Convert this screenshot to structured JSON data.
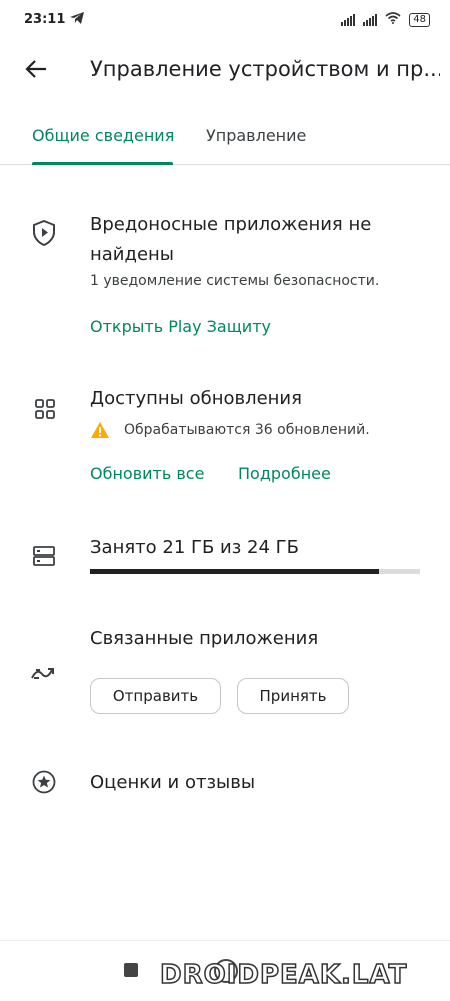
{
  "status": {
    "time": "23:11",
    "battery": "48"
  },
  "appbar": {
    "title": "Управление устройством и пр..."
  },
  "tabs": [
    {
      "label": "Общие сведения",
      "active": true
    },
    {
      "label": "Управление",
      "active": false
    }
  ],
  "protect": {
    "title": "Вредоносные приложения не найдены",
    "subtitle": "1 уведомление системы безопасности.",
    "link": "Открыть Play Защиту"
  },
  "updates": {
    "title": "Доступны обновления",
    "subtitle": "Обрабатываются 36 обновлений.",
    "update_all": "Обновить все",
    "details": "Подробнее"
  },
  "storage": {
    "label": "Занято 21 ГБ из 24 ГБ",
    "used_fraction": 0.875
  },
  "connected": {
    "title": "Связанные приложения",
    "send": "Отправить",
    "receive": "Принять"
  },
  "ratings": {
    "title": "Оценки и отзывы"
  },
  "watermark": "DROIDPEAK.LAT",
  "colors": {
    "accent": "#01875f",
    "warning": "#f9ab00"
  }
}
